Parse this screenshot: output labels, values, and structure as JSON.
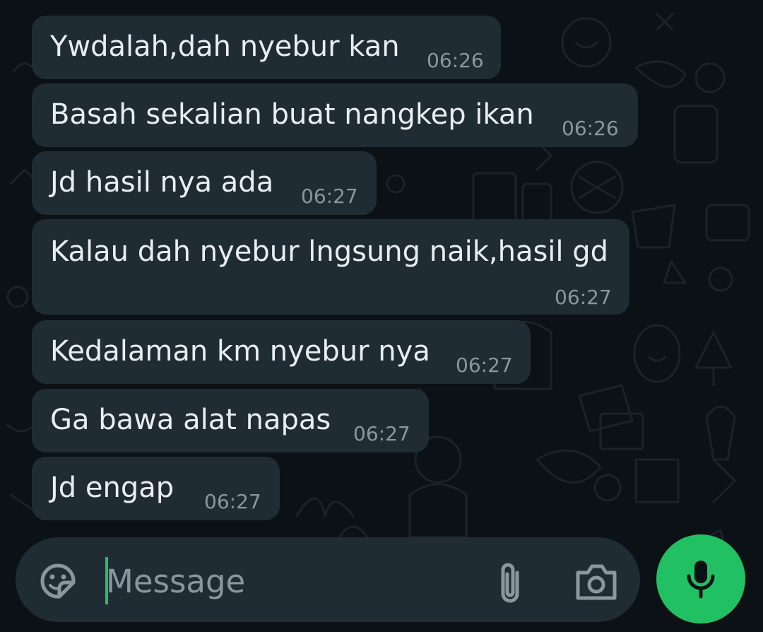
{
  "theme": {
    "background": "#0b1114",
    "bubble_incoming": "#1f2c33",
    "text_primary": "#e9edef",
    "text_secondary": "#8c979d",
    "accent": "#21c063"
  },
  "messages": [
    {
      "text": "Ywdalah,dah nyebur kan",
      "time": "06:26"
    },
    {
      "text": "Basah sekalian buat nangkep ikan",
      "time": "06:26"
    },
    {
      "text": "Jd hasil nya ada",
      "time": "06:27"
    },
    {
      "text": "Kalau dah nyebur lngsung naik,hasil gd",
      "time": "06:27"
    },
    {
      "text": "Kedalaman km nyebur nya",
      "time": "06:27"
    },
    {
      "text": "Ga bawa alat napas",
      "time": "06:27"
    },
    {
      "text": "Jd engap",
      "time": "06:27"
    }
  ],
  "composer": {
    "placeholder": "Message",
    "value": "",
    "emoji_icon": "sticker-emoji-icon",
    "attach_icon": "paperclip-icon",
    "camera_icon": "camera-icon"
  },
  "mic_button": {
    "icon": "microphone-icon"
  }
}
